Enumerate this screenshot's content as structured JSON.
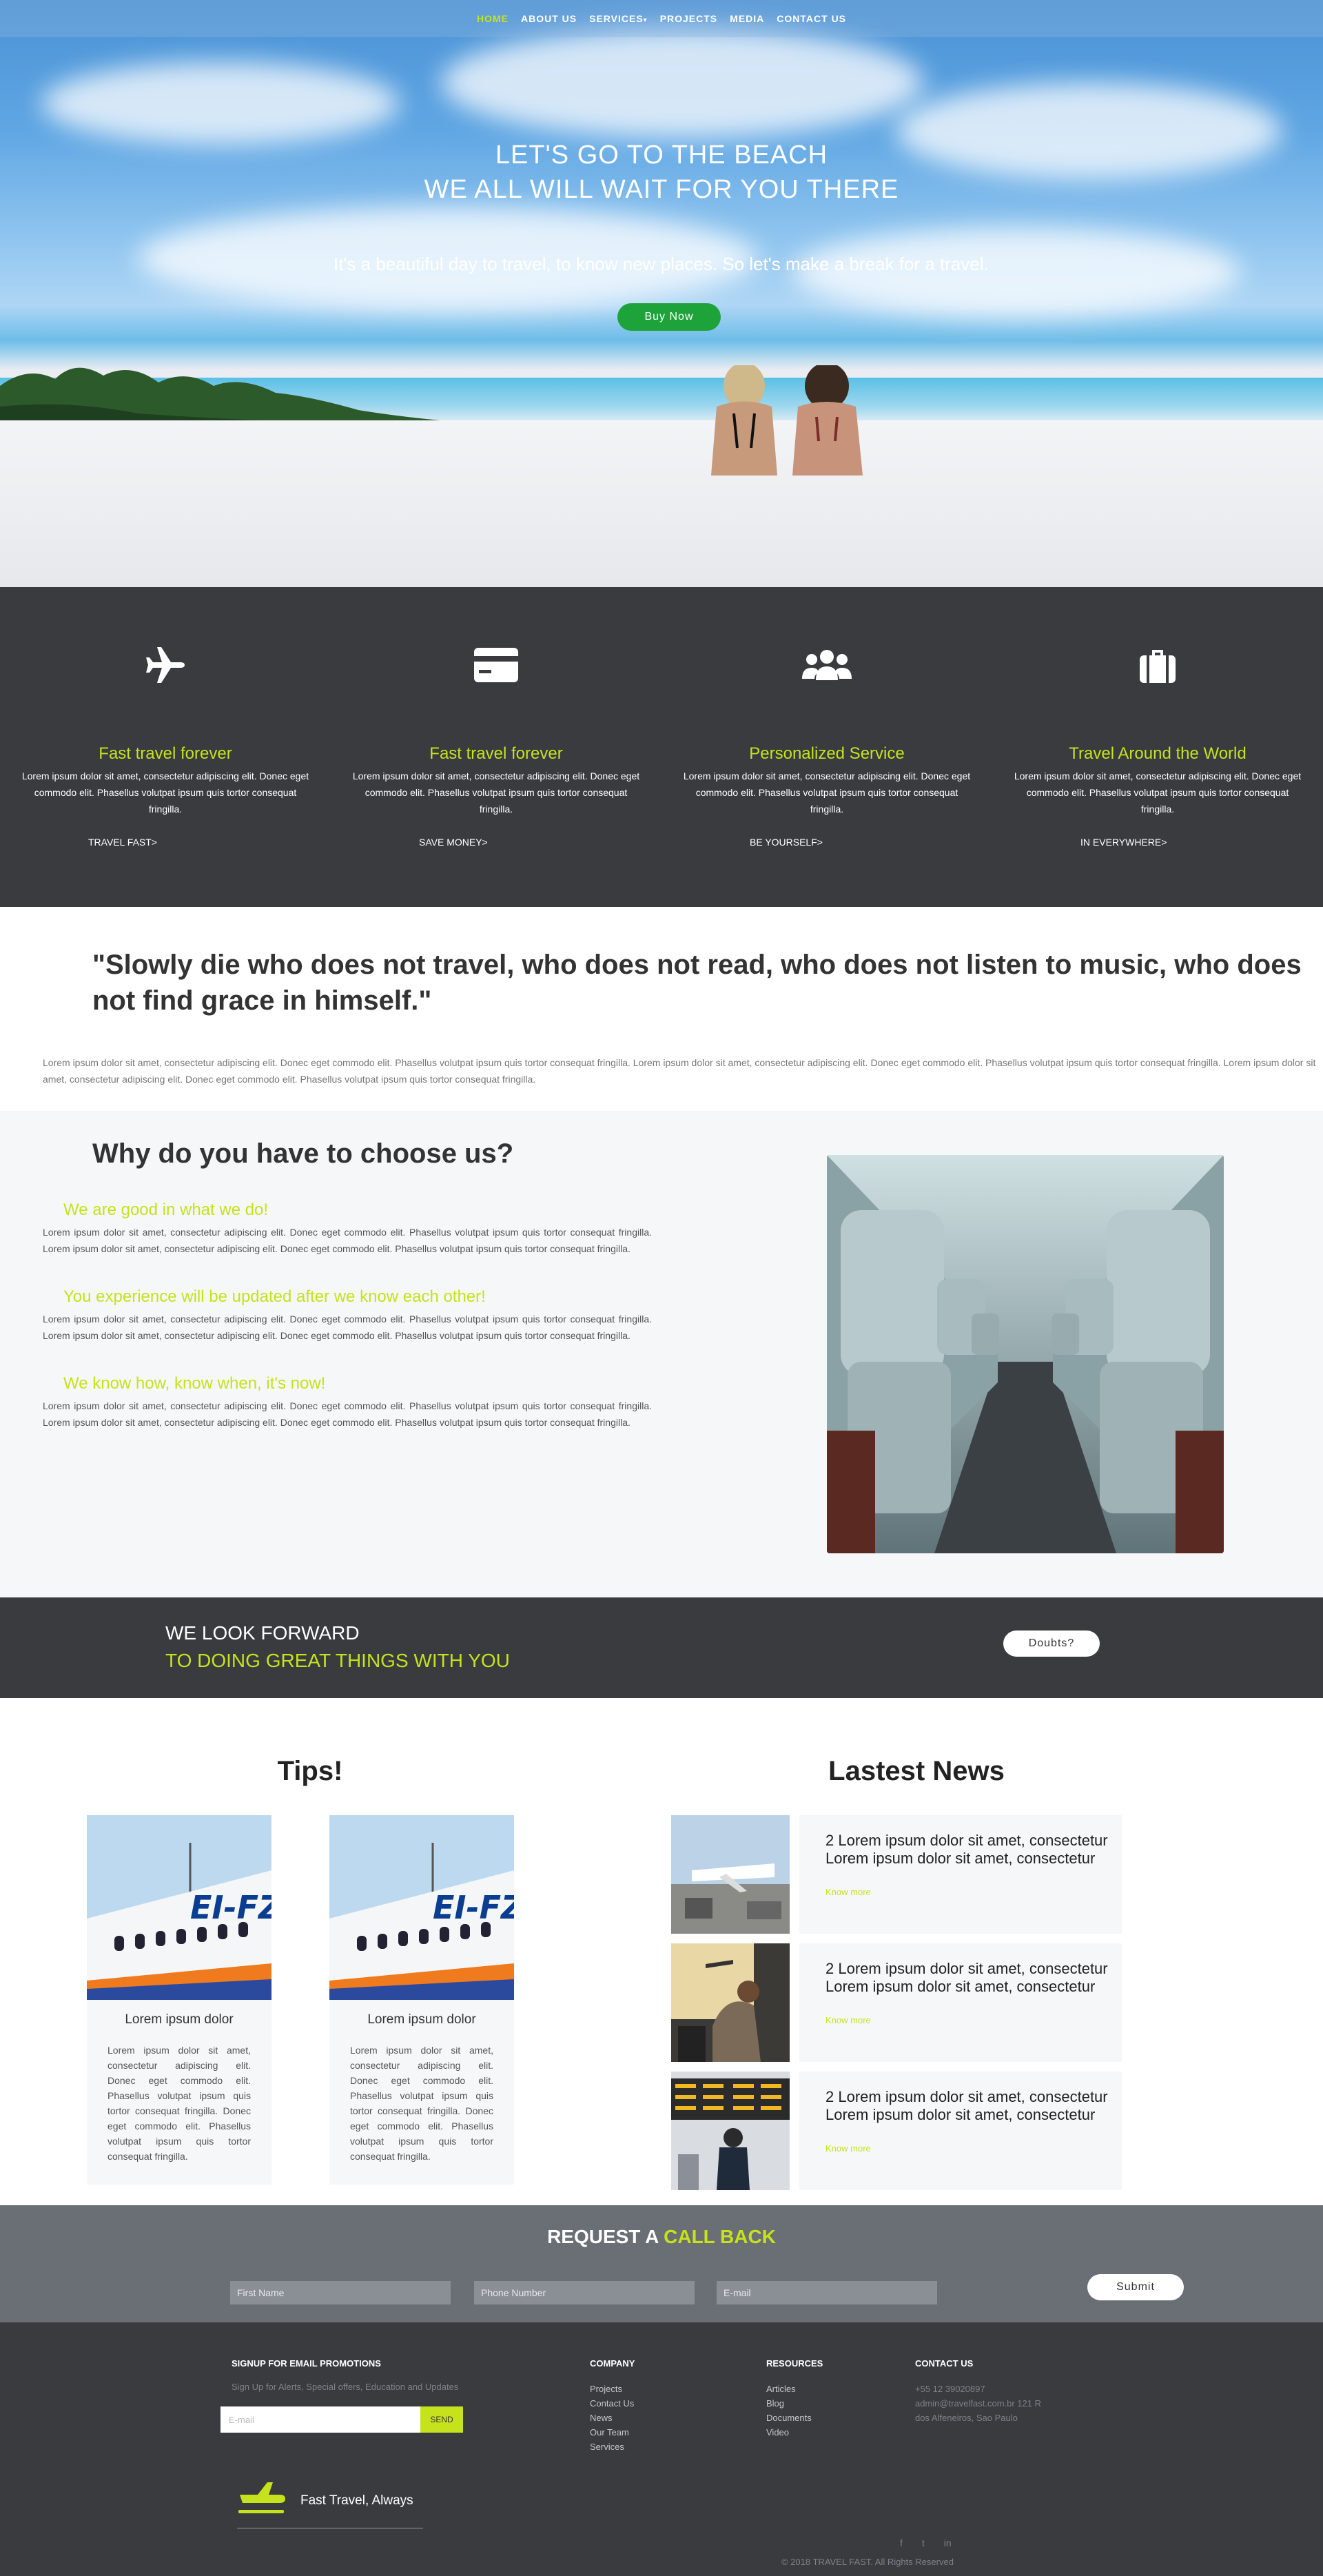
{
  "nav": {
    "items": [
      "HOME",
      "ABOUT US",
      "SERVICES",
      "PROJECTS",
      "MEDIA",
      "CONTACT US"
    ],
    "caret": "▾"
  },
  "hero": {
    "title_line1": "LET'S GO TO THE BEACH",
    "title_line2": "WE ALL WILL WAIT FOR YOU THERE",
    "subtitle": "It's a beautiful day to travel, to know new places. So let's make a break for a travel.",
    "button": "Buy Now"
  },
  "features": [
    {
      "icon": "airplane-icon",
      "title": "Fast travel forever",
      "text": "Lorem ipsum dolor sit amet, consectetur adipiscing elit. Donec eget commodo elit. Phasellus volutpat ipsum quis tortor consequat fringilla.",
      "link": "TRAVEL FAST>"
    },
    {
      "icon": "credit-card-icon",
      "title": "Fast travel forever",
      "text": "Lorem ipsum dolor sit amet, consectetur adipiscing elit. Donec eget commodo elit. Phasellus volutpat ipsum quis tortor consequat fringilla.",
      "link": "SAVE MONEY>"
    },
    {
      "icon": "users-icon",
      "title": "Personalized Service",
      "text": "Lorem ipsum dolor sit amet, consectetur adipiscing elit. Donec eget commodo elit. Phasellus volutpat ipsum quis tortor consequat fringilla.",
      "link": "BE YOURSELF>"
    },
    {
      "icon": "suitcase-icon",
      "title": "Travel Around the World",
      "text": "Lorem ipsum dolor sit amet, consectetur adipiscing elit. Donec eget commodo elit. Phasellus volutpat ipsum quis tortor consequat fringilla.",
      "link": "IN EVERYWHERE>"
    }
  ],
  "quote": {
    "text": "\"Slowly die who does not travel, who does not read, who does not listen to music, who does not find grace in himself.\"",
    "lorem": "Lorem ipsum dolor sit amet, consectetur adipiscing elit. Donec eget commodo elit. Phasellus volutpat ipsum quis tortor consequat fringilla. Lorem ipsum dolor sit amet, consectetur adipiscing elit. Donec eget commodo elit. Phasellus volutpat ipsum quis tortor consequat fringilla. Lorem ipsum dolor sit amet, consectetur adipiscing elit. Donec eget commodo elit. Phasellus volutpat ipsum quis tortor consequat fringilla."
  },
  "why": {
    "title": "Why do you have to choose us?",
    "items": [
      {
        "heading": "We are good in what we do!",
        "text": "Lorem ipsum dolor sit amet, consectetur adipiscing elit. Donec eget commodo elit. Phasellus volutpat ipsum quis tortor consequat fringilla. Lorem ipsum dolor sit amet, consectetur adipiscing elit. Donec eget commodo elit. Phasellus volutpat ipsum quis tortor consequat fringilla."
      },
      {
        "heading": "You experience will be updated after we know each other!",
        "text": "Lorem ipsum dolor sit amet, consectetur adipiscing elit. Donec eget commodo elit. Phasellus volutpat ipsum quis tortor consequat fringilla. Lorem ipsum dolor sit amet, consectetur adipiscing elit. Donec eget commodo elit. Phasellus volutpat ipsum quis tortor consequat fringilla."
      },
      {
        "heading": "We know how, know when, it's now!",
        "text": "Lorem ipsum dolor sit amet, consectetur adipiscing elit. Donec eget commodo elit. Phasellus volutpat ipsum quis tortor consequat fringilla. Lorem ipsum dolor sit amet, consectetur adipiscing elit. Donec eget commodo elit. Phasellus volutpat ipsum quis tortor consequat fringilla."
      }
    ]
  },
  "forward": {
    "line1": "WE LOOK FORWARD",
    "line2": "TO DOING GREAT THINGS WITH YOU",
    "button": "Doubts?"
  },
  "tips": {
    "title": "Tips!",
    "cards": [
      {
        "title": "Lorem ipsum dolor",
        "text": "Lorem ipsum dolor sit amet, consectetur adipiscing elit. Donec eget commodo elit. Phasellus volutpat ipsum quis tortor consequat fringilla. Donec eget commodo elit. Phasellus volutpat ipsum quis tortor consequat fringilla.",
        "plane_text": "EI-FZ"
      },
      {
        "title": "Lorem ipsum dolor",
        "text": "Lorem ipsum dolor sit amet, consectetur adipiscing elit. Donec eget commodo elit. Phasellus volutpat ipsum quis tortor consequat fringilla. Donec eget commodo elit. Phasellus volutpat ipsum quis tortor consequat fringilla.",
        "plane_text": "EI-FZ"
      }
    ]
  },
  "news": {
    "title": "Lastest News",
    "items": [
      {
        "title": "2 Lorem ipsum dolor sit amet, consectetur Lorem ipsum dolor sit amet, consectetur",
        "link": "Know more",
        "image": "airport-runway"
      },
      {
        "title": "2 Lorem ipsum dolor sit amet, consectetur Lorem ipsum dolor sit amet, consectetur",
        "link": "Know more",
        "image": "traveler-lounge"
      },
      {
        "title": "2 Lorem ipsum dolor sit amet, consectetur Lorem ipsum dolor sit amet, consectetur",
        "link": "Know more",
        "image": "departure-board"
      }
    ]
  },
  "callback": {
    "title_prefix": "REQUEST A ",
    "title_highlight": "CALL BACK",
    "first_name_placeholder": "First Name",
    "phone_placeholder": "Phone Number",
    "email_placeholder": "E-mail",
    "submit": "Submit"
  },
  "footer": {
    "signup_title": "SIGNUP FOR EMAIL PROMOTIONS",
    "signup_sub": "Sign Up for Alerts, Special offers, Education and Updates",
    "email_placeholder": "E-mail",
    "send": "SEND",
    "company_title": "COMPANY",
    "company_links": [
      "Projects",
      "Contact Us",
      "News",
      "Our Team",
      "Services"
    ],
    "resources_title": "RESOURCES",
    "resources_links": [
      "Articles",
      "Blog",
      "Documents",
      "Video"
    ],
    "contact_title": "CONTACT US",
    "contact_phone": "+55 12 39020897",
    "contact_email_line1": "admin@travelfast.com.br 121 R",
    "contact_address": "dos Alfeneiros, Sao Paulo",
    "tagline": "Fast Travel, Always",
    "social": [
      "f",
      "t",
      "in"
    ],
    "copyright": "© 2018 TRAVEL FAST. All Rights Reserved"
  },
  "colors": {
    "accent": "#c6e21c",
    "dark": "#3a3b3f",
    "button_green": "#1ea33b",
    "light_bg": "#f6f7f9"
  }
}
